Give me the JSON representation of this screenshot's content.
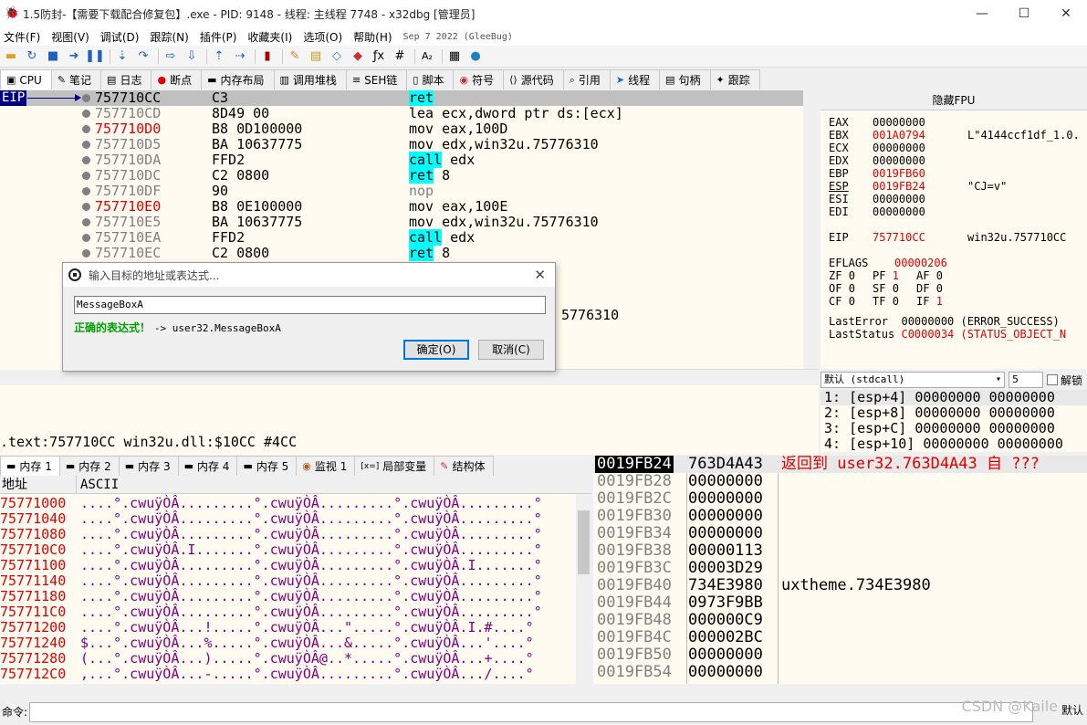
{
  "titlebar": {
    "title": "1.5防封-【需要下载配合修复包】.exe - PID: 9148 - 线程: 主线程 7748 - x32dbg [管理员]",
    "minimize": "—",
    "maximize": "☐",
    "close": "✕"
  },
  "menubar": {
    "items": [
      "文件(F)",
      "视图(V)",
      "调试(D)",
      "跟踪(N)",
      "插件(P)",
      "收藏夹(I)",
      "选项(O)",
      "帮助(H)"
    ],
    "date": "Sep 7 2022 (GleeBug)"
  },
  "tabs": [
    {
      "label": "CPU",
      "icon": "cpu-icon"
    },
    {
      "label": "笔记",
      "icon": "notes-icon"
    },
    {
      "label": "日志",
      "icon": "log-icon"
    },
    {
      "label": "断点",
      "icon": "breakpoint-icon"
    },
    {
      "label": "内存布局",
      "icon": "memory-map-icon"
    },
    {
      "label": "调用堆栈",
      "icon": "call-stack-icon"
    },
    {
      "label": "SEH链",
      "icon": "seh-icon"
    },
    {
      "label": "脚本",
      "icon": "script-icon"
    },
    {
      "label": "符号",
      "icon": "symbols-icon"
    },
    {
      "label": "源代码",
      "icon": "source-icon"
    },
    {
      "label": "引用",
      "icon": "references-icon"
    },
    {
      "label": "线程",
      "icon": "threads-icon"
    },
    {
      "label": "句柄",
      "icon": "handles-icon"
    },
    {
      "label": "跟踪",
      "icon": "trace-icon"
    }
  ],
  "disasm": {
    "eip_label": "EIP",
    "rows": [
      {
        "addr": "757710CC",
        "bytes": "C3",
        "instr": "ret",
        "cur": true
      },
      {
        "addr": "757710CD",
        "bytes": "8D49 00",
        "instr": "lea ecx,dword ptr ds:[ecx]"
      },
      {
        "addr": "757710D0",
        "bytes": "B8 0D100000",
        "instr": "mov eax,100D",
        "red": true
      },
      {
        "addr": "757710D5",
        "bytes": "BA 10637775",
        "instr": "mov edx,win32u.75776310"
      },
      {
        "addr": "757710DA",
        "bytes": "FFD2",
        "instr": "call edx"
      },
      {
        "addr": "757710DC",
        "bytes": "C2 0800",
        "instr": "ret 8"
      },
      {
        "addr": "757710DF",
        "bytes": "90",
        "instr": "nop"
      },
      {
        "addr": "757710E0",
        "bytes": "B8 0E100000",
        "instr": "mov eax,100E",
        "red": true
      },
      {
        "addr": "757710E5",
        "bytes": "BA 10637775",
        "instr": "mov edx,win32u.75776310"
      },
      {
        "addr": "757710EA",
        "bytes": "FFD2",
        "instr": "call edx"
      },
      {
        "addr": "757710EC",
        "bytes": "C2 0800",
        "instr": "ret 8"
      }
    ],
    "partial_text": "5776310"
  },
  "registers": {
    "fpu_toggle": "隐藏FPU",
    "rows": [
      {
        "name": "EAX",
        "value": "00000000",
        "comment": ""
      },
      {
        "name": "EBX",
        "value": "001A0794",
        "comment": "L\"4144ccf1df_1.0.",
        "red": true
      },
      {
        "name": "ECX",
        "value": "00000000",
        "comment": ""
      },
      {
        "name": "EDX",
        "value": "00000000",
        "comment": ""
      },
      {
        "name": "EBP",
        "value": "0019FB60",
        "comment": "",
        "red": true
      },
      {
        "name": "ESP",
        "value": "0019FB24",
        "comment": "\"CJ=v\"",
        "red": true,
        "underline": true
      },
      {
        "name": "ESI",
        "value": "00000000",
        "comment": ""
      },
      {
        "name": "EDI",
        "value": "00000000",
        "comment": ""
      },
      {
        "name": "EIP",
        "value": "757710CC",
        "comment": "win32u.757710CC",
        "red": true,
        "gap": true
      }
    ],
    "eflags_label": "EFLAGS",
    "eflags_value": "00000206",
    "flags": [
      [
        "ZF",
        "0",
        "PF",
        "1",
        "AF",
        "0"
      ],
      [
        "OF",
        "0",
        "SF",
        "0",
        "DF",
        "0"
      ],
      [
        "CF",
        "0",
        "TF",
        "0",
        "IF",
        "1"
      ]
    ],
    "lasterror_label": "LastError",
    "lasterror_value": "00000000 (ERROR_SUCCESS)",
    "laststatus_label": "LastStatus",
    "laststatus_value": "C0000034 (STATUS_OBJECT_N"
  },
  "callconv": {
    "selected": "默认 (stdcall)",
    "count": "5",
    "unlock_label": "解锁"
  },
  "args": [
    "1: [esp+4] 00000000 00000000",
    "2: [esp+8] 00000000 00000000",
    "3: [esp+C] 00000000 00000000",
    "4: [esp+10] 00000000 00000000"
  ],
  "info": {
    "line": ".text:757710CC win32u.dll:$10CC #4CC"
  },
  "dumptabs": [
    {
      "label": "内存 1",
      "icon": "memory-icon"
    },
    {
      "label": "内存 2",
      "icon": "memory-icon"
    },
    {
      "label": "内存 3",
      "icon": "memory-icon"
    },
    {
      "label": "内存 4",
      "icon": "memory-icon"
    },
    {
      "label": "内存 5",
      "icon": "memory-icon"
    },
    {
      "label": "监视 1",
      "icon": "watch-icon"
    },
    {
      "label": "局部变量",
      "icon": "locals-icon"
    },
    {
      "label": "结构体",
      "icon": "struct-icon"
    }
  ],
  "dump": {
    "header_addr": "地址",
    "header_ascii": "ASCII",
    "rows": [
      {
        "addr": "75771000",
        "ascii": "....°.cwuÿÒÂ.........°.cwuÿÒÂ.........°.cwuÿÒÂ.........°"
      },
      {
        "addr": "75771040",
        "ascii": "....°.cwuÿÒÂ.........°.cwuÿÒÂ.........°.cwuÿÒÂ.........°"
      },
      {
        "addr": "75771080",
        "ascii": "....°.cwuÿÒÂ.........°.cwuÿÒÂ.........°.cwuÿÒÂ.........°"
      },
      {
        "addr": "757710C0",
        "ascii": "....°.cwuÿÒÂ.I.......°.cwuÿÒÂ.........°.cwuÿÒÂ.........°"
      },
      {
        "addr": "75771100",
        "ascii": "....°.cwuÿÒÂ.........°.cwuÿÒÂ.........°.cwuÿÒÂ.I.......°"
      },
      {
        "addr": "75771140",
        "ascii": "....°.cwuÿÒÂ.........°.cwuÿÒÂ.........°.cwuÿÒÂ.........°"
      },
      {
        "addr": "75771180",
        "ascii": "....°.cwuÿÒÂ.........°.cwuÿÒÂ.........°.cwuÿÒÂ.........°"
      },
      {
        "addr": "757711C0",
        "ascii": "....°.cwuÿÒÂ.........°.cwuÿÒÂ.........°.cwuÿÒÂ.........°"
      },
      {
        "addr": "75771200",
        "ascii": "....°.cwuÿÒÂ...!.....°.cwuÿÒÂ...\".....°.cwuÿÒÂ.I.#....°"
      },
      {
        "addr": "75771240",
        "ascii": "$...°.cwuÿÒÂ...%.....°.cwuÿÒÂ...&.....°.cwuÿÒÂ...'....°"
      },
      {
        "addr": "75771280",
        "ascii": "(...°.cwuÿÒÂ...).....°.cwuÿÒÂ@..*.....°.cwuÿÒÂ...+....°"
      },
      {
        "addr": "757712C0",
        "ascii": ",...°.cwuÿÒÂ...-.....°.cwuÿÒÂ.........°.cwuÿÒÂ.../....°"
      }
    ]
  },
  "stack": {
    "rows": [
      {
        "addr": "0019FB24",
        "value": "763D4A43",
        "comment": "返回到 user32.763D4A43 自 ???",
        "cur": true
      },
      {
        "addr": "0019FB28",
        "value": "00000000",
        "comment": ""
      },
      {
        "addr": "0019FB2C",
        "value": "00000000",
        "comment": ""
      },
      {
        "addr": "0019FB30",
        "value": "00000000",
        "comment": ""
      },
      {
        "addr": "0019FB34",
        "value": "00000000",
        "comment": ""
      },
      {
        "addr": "0019FB38",
        "value": "00000113",
        "comment": ""
      },
      {
        "addr": "0019FB3C",
        "value": "00003D29",
        "comment": ""
      },
      {
        "addr": "0019FB40",
        "value": "734E3980",
        "comment": "uxtheme.734E3980"
      },
      {
        "addr": "0019FB44",
        "value": "0973F9BB",
        "comment": ""
      },
      {
        "addr": "0019FB48",
        "value": "000000C9",
        "comment": ""
      },
      {
        "addr": "0019FB4C",
        "value": "000002BC",
        "comment": ""
      },
      {
        "addr": "0019FB50",
        "value": "00000000",
        "comment": ""
      },
      {
        "addr": "0019FB54",
        "value": "00000000",
        "comment": ""
      }
    ]
  },
  "cmdbar": {
    "label": "命令:",
    "default_label": "默认"
  },
  "watermark": "CSDN @Kaile",
  "dialog": {
    "title": "输入目标的地址或表达式...",
    "input_value": "MessageBoxA",
    "status_ok": "正确的表达式！",
    "status_result": "-> user32.MessageBoxA",
    "ok_label": "确定(O)",
    "cancel_label": "取消(C)"
  },
  "colors": {
    "addr_red": "#e00000",
    "highlight_cyan": "#00ffff",
    "eip_blue": "#000080",
    "pane_bg": "#fffbf0"
  }
}
